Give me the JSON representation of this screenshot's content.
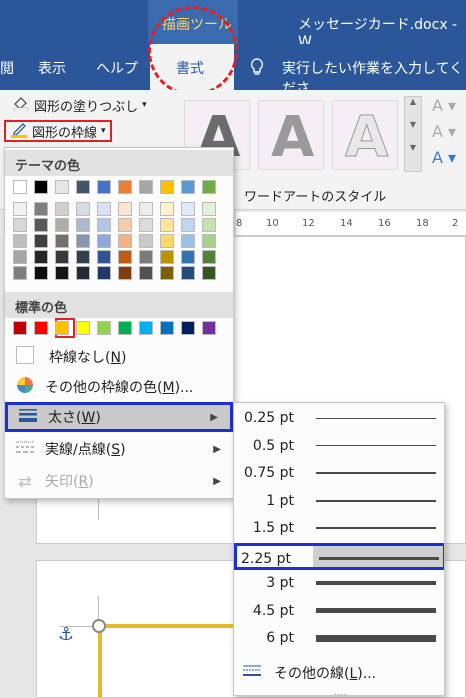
{
  "titlebar": {
    "context_tab": "描画ツール",
    "document": "メッセージカード.docx - W"
  },
  "tabs": {
    "partial": "閲",
    "view": "表示",
    "help": "ヘルプ",
    "format": "書式",
    "tell_me": "実行したい作業を入力してくださ"
  },
  "ribbon": {
    "shape_fill": "図形の塗りつぶし",
    "shape_outline": "図形の枠線",
    "wordart_letter": "A",
    "wordart_group": "ワードアートのスタイル"
  },
  "ruler": [
    "8",
    "10",
    "12",
    "14",
    "16",
    "18",
    "2"
  ],
  "menu": {
    "theme_colors_header": "テーマの色",
    "theme_colors": [
      "#ffffff",
      "#000000",
      "#e7e6e6",
      "#44546a",
      "#4472c4",
      "#ed7d31",
      "#a5a5a5",
      "#ffc000",
      "#5b9bd5",
      "#70ad47"
    ],
    "theme_shades": [
      [
        "#f2f2f2",
        "#7f7f7f",
        "#d0cece",
        "#d6dce4",
        "#d9e2f3",
        "#fbe5d5",
        "#ededed",
        "#fff2cc",
        "#deebf6",
        "#e2efd9"
      ],
      [
        "#d8d8d8",
        "#595959",
        "#aeabab",
        "#adb9ca",
        "#b4c6e7",
        "#f7cbac",
        "#dbdbdb",
        "#fee599",
        "#bdd7ee",
        "#c5e0b3"
      ],
      [
        "#bfbfbf",
        "#3f3f3f",
        "#757070",
        "#8496b0",
        "#8eaadb",
        "#f4b183",
        "#c9c9c9",
        "#ffd965",
        "#9cc3e5",
        "#a8d08d"
      ],
      [
        "#a5a5a5",
        "#262626",
        "#3a3838",
        "#323f4f",
        "#2f5496",
        "#c55a11",
        "#7b7b7b",
        "#bf9000",
        "#2e75b5",
        "#538135"
      ],
      [
        "#7f7f7f",
        "#0c0c0c",
        "#171616",
        "#222a35",
        "#1f3864",
        "#833c0b",
        "#525252",
        "#7f6000",
        "#1e4e79",
        "#375623"
      ]
    ],
    "standard_colors_header": "標準の色",
    "standard_colors": [
      "#c00000",
      "#ff0000",
      "#ffc000",
      "#ffff00",
      "#92d050",
      "#00b050",
      "#00b0f0",
      "#0070c0",
      "#002060",
      "#7030a0"
    ],
    "no_outline": {
      "text": "枠線なし(",
      "key": "N",
      "end": ")"
    },
    "more_colors": {
      "text": "その他の枠線の色(",
      "key": "M",
      "end": ")..."
    },
    "weight": {
      "text": "太さ(",
      "key": "W",
      "end": ")"
    },
    "dashes": {
      "text": "実線/点線(",
      "key": "S",
      "end": ")"
    },
    "arrows": {
      "text": "矢印(",
      "key": "R",
      "end": ")"
    }
  },
  "submenu": {
    "weights": [
      "0.25 pt",
      "0.5 pt",
      "0.75 pt",
      "1 pt",
      "1.5 pt",
      "2.25 pt",
      "3 pt",
      "4.5 pt",
      "6 pt"
    ],
    "selected": "2.25 pt",
    "more_lines": {
      "text": "その他の線(",
      "key": "L",
      "end": ")..."
    }
  },
  "colors": {
    "ribbon_blue": "#2b579a",
    "highlight_red": "#dd2222",
    "highlight_blue": "#1d2fd6",
    "shape_yellow": "#e8b82a"
  }
}
